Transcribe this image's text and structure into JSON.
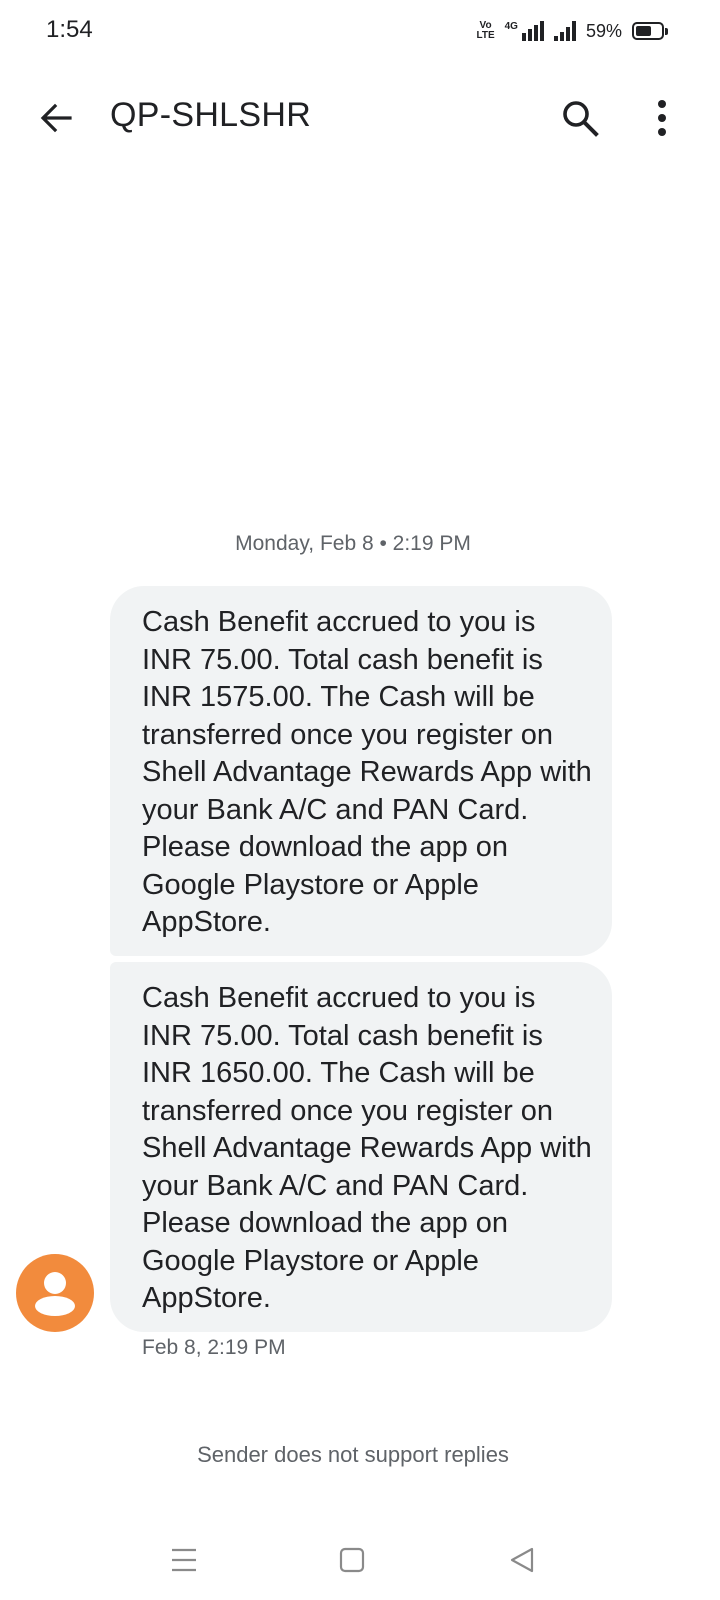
{
  "status_bar": {
    "time": "1:54",
    "volte_line1": "Vo",
    "volte_line2": "LTE",
    "network": "4G",
    "battery": "59%"
  },
  "app_bar": {
    "title": "QP-SHLSHR",
    "icons": [
      "arrow-back-icon",
      "search-icon",
      "more-vert-icon"
    ]
  },
  "conversation": {
    "date_header": "Monday, Feb 8 • 2:19 PM",
    "messages": [
      {
        "text": "Cash Benefit accrued to you is INR 75.00. Total cash benefit is INR 1575.00. The Cash will be transferred once you register on Shell Advantage Rewards App with your Bank A/C and PAN Card. Please download the app on Google Playstore or Apple AppStore."
      },
      {
        "text": "Cash Benefit accrued to you is INR 75.00. Total cash benefit is INR 1650.00. The Cash will be transferred once you register on Shell Advantage Rewards App with your Bank A/C and PAN Card. Please download the app on Google Playstore or Apple AppStore."
      }
    ],
    "last_timestamp": "Feb 8, 2:19 PM",
    "avatar_color": "#f28b3d",
    "bubble_color": "#f1f3f4"
  },
  "footer": {
    "no_reply_text": "Sender does not support replies"
  },
  "nav_bar": {
    "icons": [
      "menu-icon",
      "home-square-icon",
      "back-triangle-icon"
    ]
  }
}
